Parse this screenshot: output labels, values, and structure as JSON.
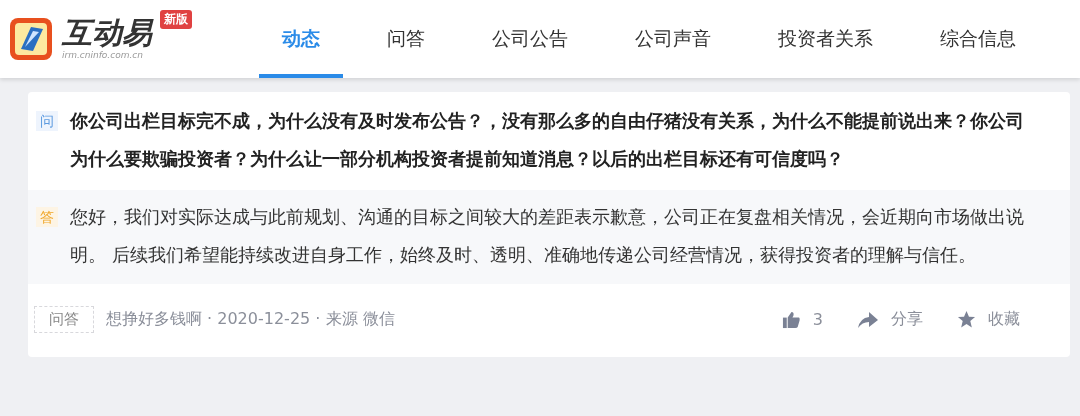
{
  "logo": {
    "name": "互动易",
    "url": "irm.cninfo.com.cn",
    "badge": "新版"
  },
  "tabs": [
    {
      "label": "动态",
      "selected": true
    },
    {
      "label": "问答",
      "selected": false
    },
    {
      "label": "公司公告",
      "selected": false
    },
    {
      "label": "公司声音",
      "selected": false
    },
    {
      "label": "投资者关系",
      "selected": false
    },
    {
      "label": "综合信息",
      "selected": false
    }
  ],
  "question": {
    "marker": "问",
    "text": "你公司出栏目标完不成，为什么没有及时发布公告？，没有那么多的自由仔猪没有关系，为什么不能提前说出来？你公司为什么要欺骗投资者？为什么让一部分机构投资者提前知道消息？以后的出栏目标还有可信度吗？"
  },
  "answer": {
    "marker": "答",
    "text": "您好，我们对实际达成与此前规划、沟通的目标之间较大的差距表示歉意，公司正在复盘相关情况，会近期向市场做出说明。 后续我们希望能持续改进自身工作，始终及时、透明、准确地传递公司经营情况，获得投资者的理解与信任。"
  },
  "footer": {
    "tag": "问答",
    "meta": "想挣好多钱啊 · 2020-12-25 · 来源 微信",
    "likes": "3",
    "share": "分享",
    "favorite": "收藏"
  }
}
